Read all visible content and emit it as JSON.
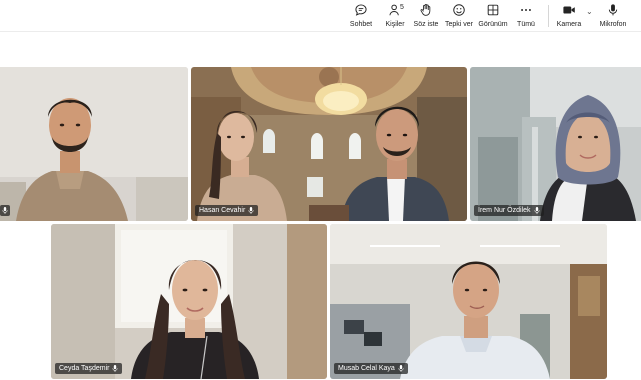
{
  "toolbar": {
    "items": [
      {
        "id": "chat",
        "label": "Sohbet",
        "icon": "chat-icon"
      },
      {
        "id": "people",
        "label": "Kişiler",
        "icon": "people-icon",
        "count": "5"
      },
      {
        "id": "raise",
        "label": "Söz iste",
        "icon": "raise-hand-icon"
      },
      {
        "id": "react",
        "label": "Tepki ver",
        "icon": "reaction-icon"
      },
      {
        "id": "view",
        "label": "Görünüm",
        "icon": "view-icon"
      },
      {
        "id": "more",
        "label": "Tümü",
        "icon": "more-icon"
      },
      {
        "id": "camera",
        "label": "Kamera",
        "icon": "camera-icon"
      },
      {
        "id": "mic",
        "label": "Mikrofon",
        "icon": "microphone-icon"
      }
    ]
  },
  "participants": [
    {
      "name": ""
    },
    {
      "name": "Hasan Cevahir"
    },
    {
      "name": "İrem Nur Özdilek"
    },
    {
      "name": "Ceyda Taşdemir"
    },
    {
      "name": "Musab Celal Kaya"
    }
  ],
  "colors": {
    "toolbar_bg": "#ffffff",
    "tag_bg": "#1e1e1e",
    "stage_bg": "#ffffff"
  }
}
